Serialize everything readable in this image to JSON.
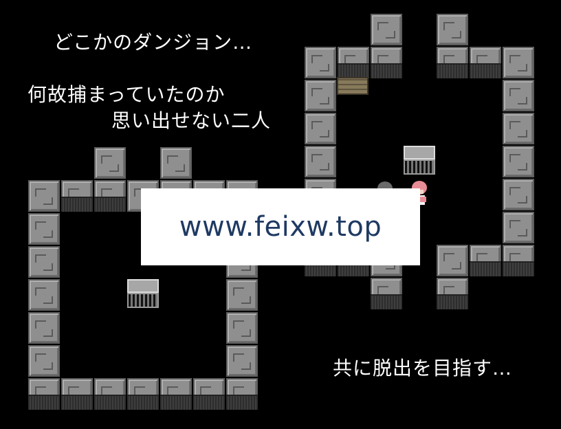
{
  "narration": {
    "line1": "どこかのダンジョン…",
    "line2": "何故捕まっていたのか",
    "line3": "思い出せない二人",
    "line4": "共に脱出を目指す…"
  },
  "watermark": {
    "text": "www.feixw.top"
  },
  "colors": {
    "background": "#000000",
    "wall": "#8f8f8f",
    "text": "#ffffff"
  },
  "scene": {
    "left_room": "stone-wall room with storage chest",
    "right_room": "stone-wall room with bench, chest and two characters",
    "characters": [
      "gray-haired-character",
      "pink-haired-character"
    ]
  }
}
